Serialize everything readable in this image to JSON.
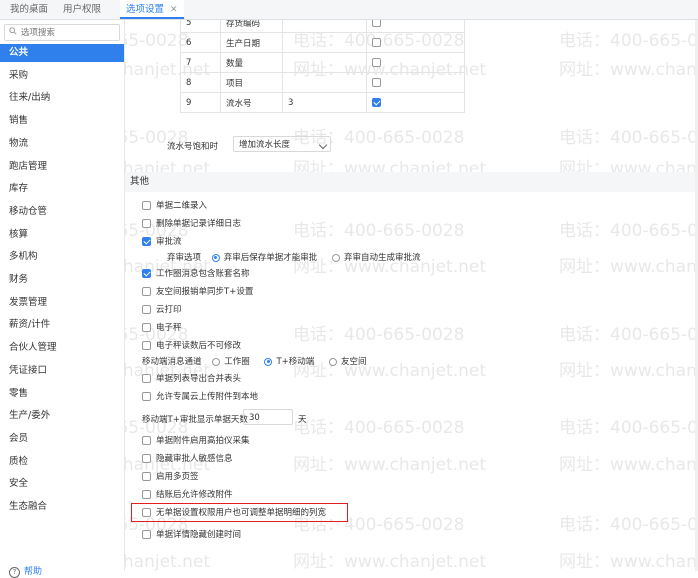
{
  "tabs": [
    {
      "label": "我的桌面"
    },
    {
      "label": "用户权限"
    },
    {
      "label": "选项设置",
      "close": "✕"
    }
  ],
  "search": {
    "placeholder": "选项搜索"
  },
  "sidebar": {
    "items": [
      "公共",
      "采购",
      "往来/出纳",
      "销售",
      "物流",
      "跑店管理",
      "库存",
      "移动仓管",
      "核算",
      "多机构",
      "财务",
      "发票管理",
      "薪资/计件",
      "合伙人管理",
      "凭证接口",
      "零售",
      "生产/委外",
      "会员",
      "质检",
      "安全",
      "生态融合"
    ],
    "active_index": 0,
    "help": "帮助"
  },
  "watermark": {
    "phone": "电话：400-665-0028",
    "site": "网址：www.chanjet.net"
  },
  "grid": {
    "rows": [
      {
        "no": "5",
        "name": "存货编码",
        "value": "",
        "checked": false
      },
      {
        "no": "6",
        "name": "生产日期",
        "value": "",
        "checked": false
      },
      {
        "no": "7",
        "name": "数量",
        "value": "",
        "checked": false
      },
      {
        "no": "8",
        "name": "项目",
        "value": "",
        "checked": false
      },
      {
        "no": "9",
        "name": "流水号",
        "value": "3",
        "checked": true
      }
    ]
  },
  "serial": {
    "label": "流水号饱和时",
    "value": "增加流水长度"
  },
  "section_other": "其他",
  "options": {
    "qr": {
      "label": "单据二维录入",
      "checked": false
    },
    "del_log": {
      "label": "删除单据记录详细日志",
      "checked": false
    },
    "approval": {
      "label": "审批流",
      "checked": true
    },
    "abandon": {
      "label": "弃审选项",
      "opt1": "弃审后保存单据才能审批",
      "opt2": "弃审自动生成审批流",
      "selected": 1
    },
    "workbench": {
      "label": "工作圈消息包含账套名称",
      "checked": true
    },
    "friend": {
      "label": "友空间报销单同步T+设置",
      "checked": false
    },
    "cloud_print": {
      "label": "云打印",
      "checked": false
    },
    "scale": {
      "label": "电子秤",
      "checked": false
    },
    "scale_lock": {
      "label": "电子秤读数后不可修改",
      "checked": false
    },
    "mobile_channel": {
      "label": "移动端消息通道",
      "opt1": "工作圈",
      "opt2": "T+移动端",
      "opt3": "友空间",
      "selected": 2
    },
    "merge_header": {
      "label": "单据列表导出合并表头",
      "checked": false
    },
    "pro_cloud": {
      "label": "允许专属云上传附件到本地",
      "checked": false
    },
    "approval_days": {
      "label": "移动端T+审批显示单据天数",
      "value": "30",
      "unit": "天"
    },
    "hd_camera": {
      "label": "单据附件启用高拍仪采集",
      "checked": false
    },
    "hide_approver": {
      "label": "隐藏审批人敏感信息",
      "checked": false
    },
    "multi_sign": {
      "label": "启用多页签",
      "checked": false
    },
    "attach_after": {
      "label": "结账后允许修改附件",
      "checked": false
    },
    "col_width": {
      "label": "无单据设置权限用户也可调整单据明细的列宽",
      "checked": false
    },
    "hide_time": {
      "label": "单据详情隐藏创建时间",
      "checked": false
    }
  },
  "colors": {
    "accent": "#2f80ed",
    "highlight": "#e02020"
  }
}
